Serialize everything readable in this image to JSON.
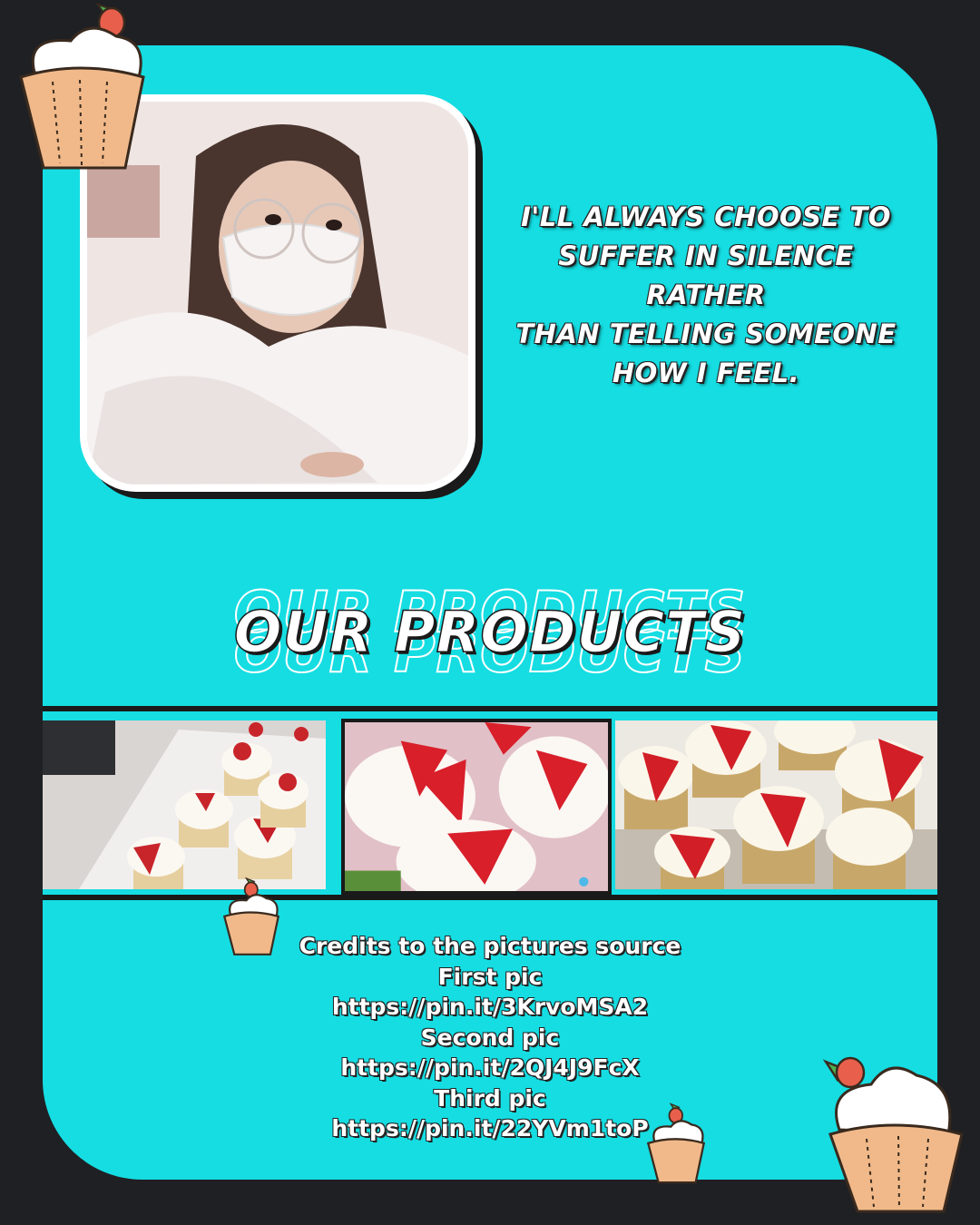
{
  "quote": {
    "line1": "I'LL ALWAYS CHOOSE TO",
    "line2": "SUFFER IN SILENCE RATHER",
    "line3": "THAN TELLING SOMEONE",
    "line4": "HOW I FEEL."
  },
  "heading": {
    "title": "OUR PRODUCTS"
  },
  "credits": {
    "title": "Credits to the pictures source",
    "items": [
      {
        "label": "First pic",
        "url": "https://pin.it/3KrvoMSA2"
      },
      {
        "label": "Second pic",
        "url": "https://pin.it/2QJ4J9FcX"
      },
      {
        "label": "Third pic",
        "url": "https://pin.it/22YVm1toP"
      }
    ]
  },
  "colors": {
    "background": "#1f2024",
    "card": "#15dde2",
    "text": "#ffffff",
    "outline": "#1a1a1a"
  },
  "icons": [
    "cupcake-icon",
    "strawberry-icon"
  ]
}
